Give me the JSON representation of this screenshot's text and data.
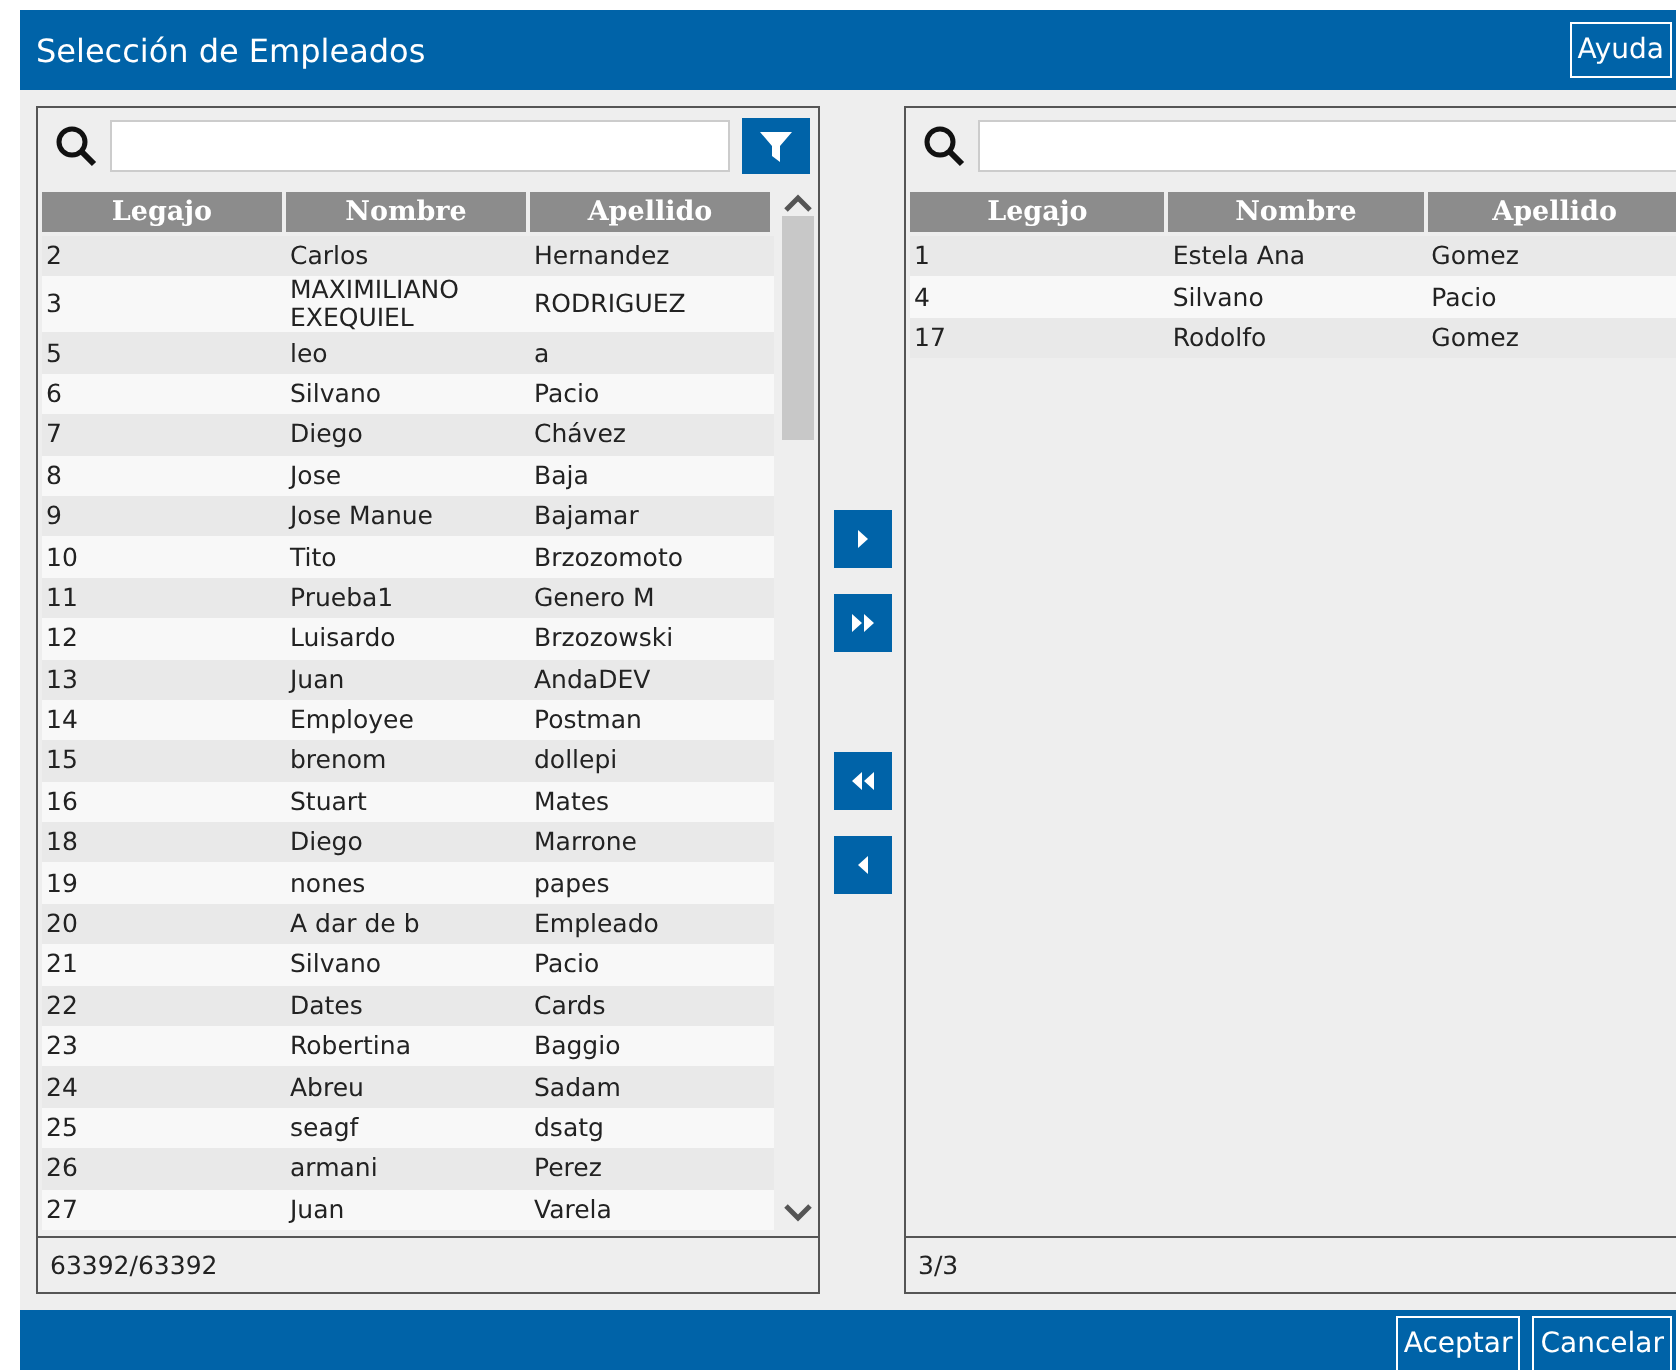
{
  "window": {
    "title": "Selección de Empleados",
    "help_button": "Ayuda"
  },
  "available": {
    "columns": [
      "Legajo",
      "Nombre",
      "Apellido"
    ],
    "rows": [
      {
        "legajo": "2",
        "nombre": "Carlos",
        "apellido": "Hernandez"
      },
      {
        "legajo": "3",
        "nombre": "MAXIMILIANO EXEQUIEL",
        "apellido": "RODRIGUEZ"
      },
      {
        "legajo": "5",
        "nombre": "leo",
        "apellido": "a"
      },
      {
        "legajo": "6",
        "nombre": "Silvano",
        "apellido": "Pacio"
      },
      {
        "legajo": "7",
        "nombre": "Diego",
        "apellido": "Chávez"
      },
      {
        "legajo": "8",
        "nombre": "Jose",
        "apellido": "Baja"
      },
      {
        "legajo": "9",
        "nombre": "Jose Manue",
        "apellido": "Bajamar"
      },
      {
        "legajo": "10",
        "nombre": "Tito",
        "apellido": "Brzozomoto"
      },
      {
        "legajo": "11",
        "nombre": "Prueba1",
        "apellido": "Genero M"
      },
      {
        "legajo": "12",
        "nombre": "Luisardo",
        "apellido": "Brzozowski"
      },
      {
        "legajo": "13",
        "nombre": "Juan",
        "apellido": "AndaDEV"
      },
      {
        "legajo": "14",
        "nombre": "Employee",
        "apellido": "Postman"
      },
      {
        "legajo": "15",
        "nombre": "brenom",
        "apellido": "dollepi"
      },
      {
        "legajo": "16",
        "nombre": "Stuart",
        "apellido": "Mates"
      },
      {
        "legajo": "18",
        "nombre": "Diego",
        "apellido": "Marrone"
      },
      {
        "legajo": "19",
        "nombre": "nones",
        "apellido": "papes"
      },
      {
        "legajo": "20",
        "nombre": "A dar de b",
        "apellido": "Empleado"
      },
      {
        "legajo": "21",
        "nombre": "Silvano",
        "apellido": "Pacio"
      },
      {
        "legajo": "22",
        "nombre": "Dates",
        "apellido": "Cards"
      },
      {
        "legajo": "23",
        "nombre": "Robertina",
        "apellido": "Baggio"
      },
      {
        "legajo": "24",
        "nombre": "Abreu",
        "apellido": "Sadam"
      },
      {
        "legajo": "25",
        "nombre": "seagf",
        "apellido": "dsatg"
      },
      {
        "legajo": "26",
        "nombre": "armani",
        "apellido": "Perez"
      },
      {
        "legajo": "27",
        "nombre": "Juan",
        "apellido": "Varela"
      }
    ],
    "count": "63392/63392"
  },
  "selected": {
    "columns": [
      "Legajo",
      "Nombre",
      "Apellido"
    ],
    "rows": [
      {
        "legajo": "1",
        "nombre": "Estela Ana",
        "apellido": "Gomez"
      },
      {
        "legajo": "4",
        "nombre": "Silvano",
        "apellido": "Pacio"
      },
      {
        "legajo": "17",
        "nombre": "Rodolfo",
        "apellido": "Gomez"
      }
    ],
    "count": "3/3"
  },
  "transfer_buttons": [
    {
      "kind": "add-one"
    },
    {
      "kind": "add-all"
    },
    {
      "kind": "remove-all"
    },
    {
      "kind": "remove-one"
    }
  ],
  "footer_buttons": [
    "Aceptar",
    "Cancelar"
  ]
}
